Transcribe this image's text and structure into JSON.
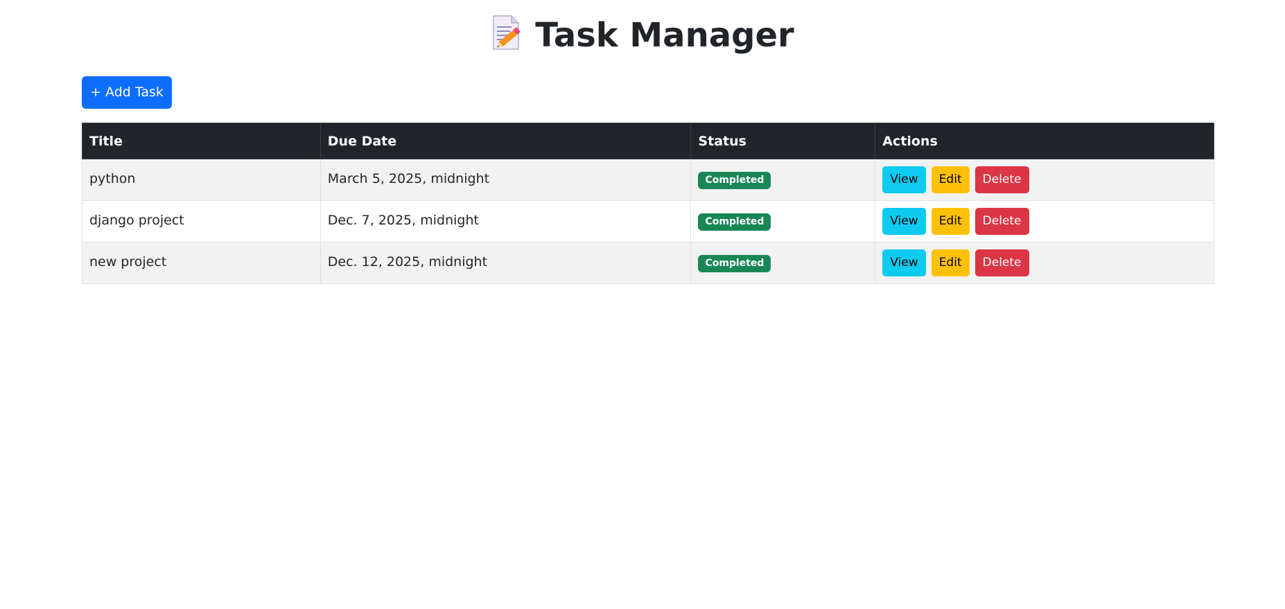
{
  "header": {
    "title": "Task Manager",
    "icon": "memo-pencil-icon"
  },
  "toolbar": {
    "add_label": "+ Add Task"
  },
  "table": {
    "columns": [
      "Title",
      "Due Date",
      "Status",
      "Actions"
    ],
    "rows": [
      {
        "title": "python",
        "due": "March 5, 2025, midnight",
        "status": "Completed"
      },
      {
        "title": "django project",
        "due": "Dec. 7, 2025, midnight",
        "status": "Completed"
      },
      {
        "title": "new project",
        "due": "Dec. 12, 2025, midnight",
        "status": "Completed"
      }
    ],
    "actions": {
      "view": "View",
      "edit": "Edit",
      "delete": "Delete"
    }
  },
  "colors": {
    "primary": "#0d6efd",
    "header_bg": "#212529",
    "success": "#198754",
    "info": "#0dcaf0",
    "warning": "#ffc107",
    "danger": "#dc3545"
  }
}
